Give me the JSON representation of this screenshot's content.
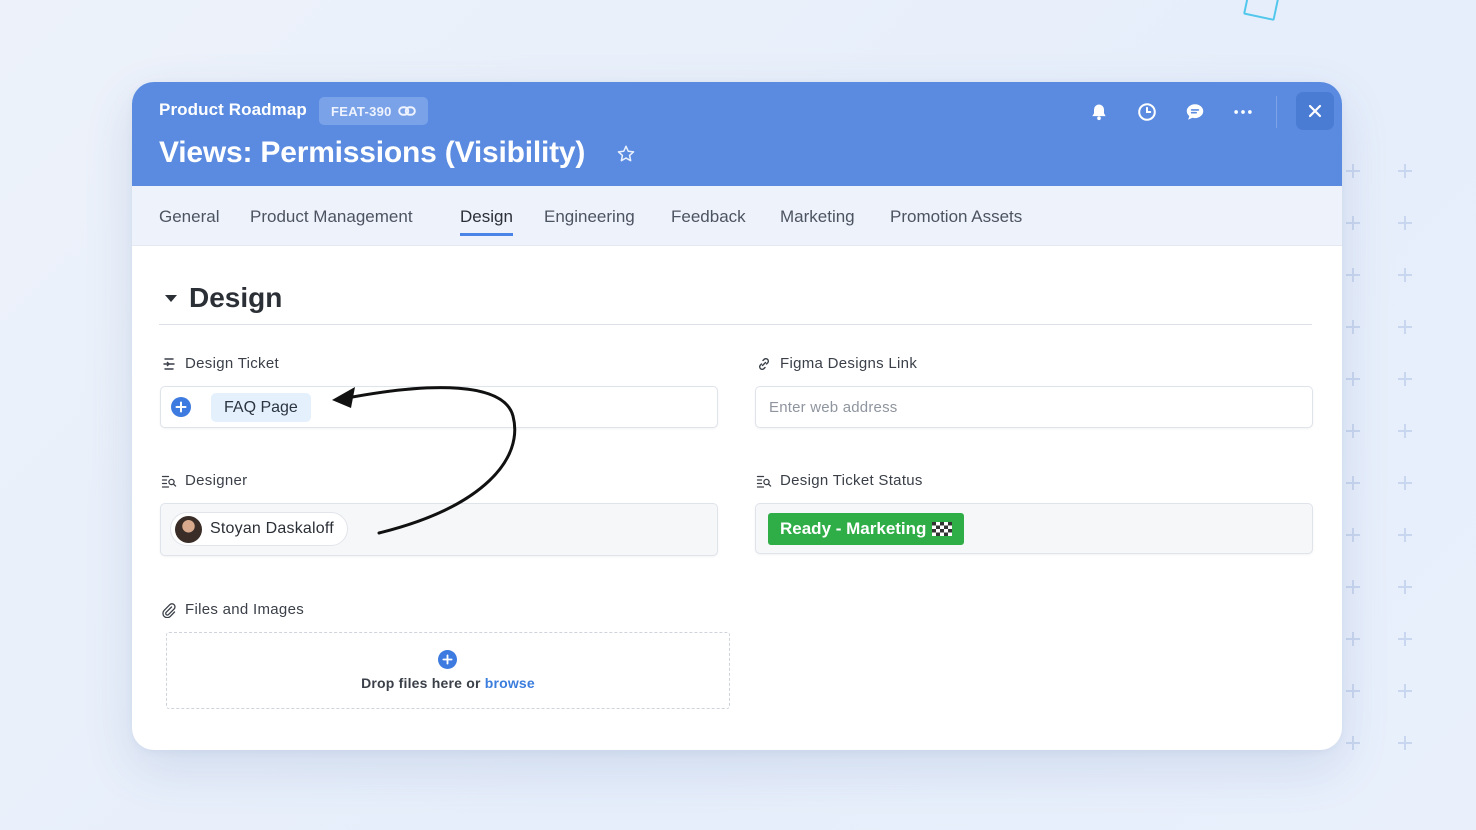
{
  "header": {
    "project": "Product Roadmap",
    "ticket_id": "FEAT-390",
    "title": "Views: Permissions (Visibility)"
  },
  "tabs": [
    {
      "label": "General"
    },
    {
      "label": "Product Management"
    },
    {
      "label": "Design",
      "active": true
    },
    {
      "label": "Engineering"
    },
    {
      "label": "Feedback"
    },
    {
      "label": "Marketing"
    },
    {
      "label": "Promotion Assets"
    }
  ],
  "section": {
    "title": "Design",
    "fields": {
      "design_ticket": {
        "label": "Design Ticket",
        "value": "FAQ Page"
      },
      "figma_link": {
        "label": "Figma Designs Link",
        "placeholder": "Enter web address"
      },
      "designer": {
        "label": "Designer",
        "value": "Stoyan Daskaloff"
      },
      "design_ticket_status": {
        "label": "Design Ticket Status",
        "value": "Ready - Marketing",
        "color": "#2fae48"
      },
      "files": {
        "label": "Files and Images",
        "drop_text": "Drop files here or ",
        "browse_link": "browse"
      }
    }
  },
  "colors": {
    "header_bg": "#5a8be0",
    "accent": "#3d7be0",
    "tab_bar_bg": "#eef2fb"
  },
  "icons": {
    "bell": "bell-icon",
    "history": "clock-icon",
    "comments": "chat-icon",
    "more": "more-icon",
    "close": "close-icon"
  }
}
